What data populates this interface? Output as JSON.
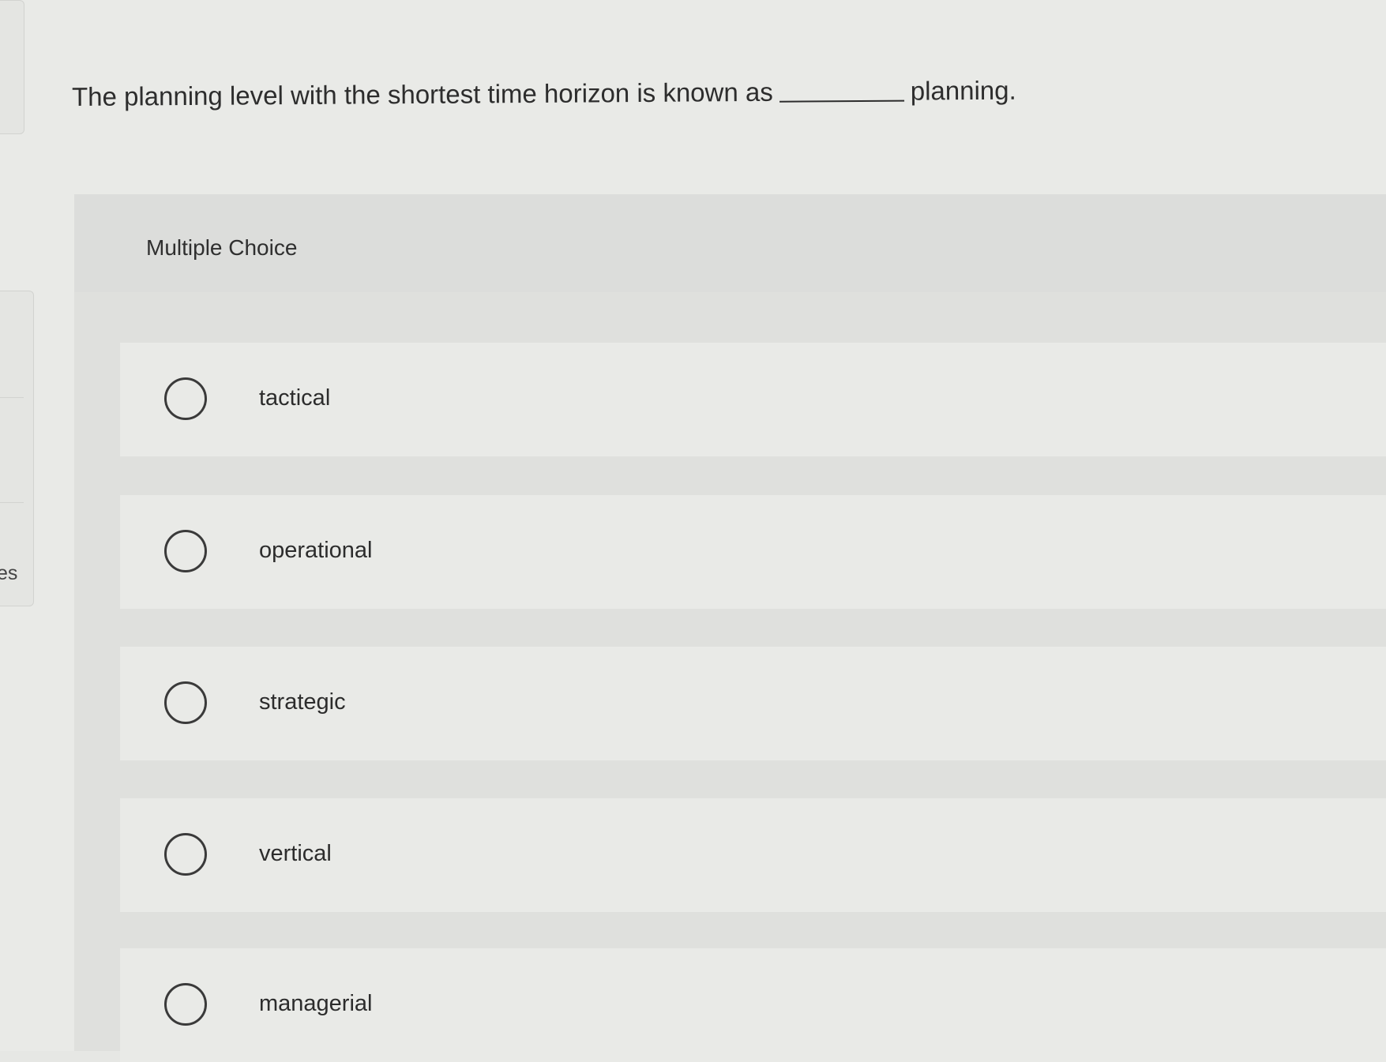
{
  "question": {
    "text_before": "The planning level with the shortest time horizon is known as",
    "text_after": "planning."
  },
  "side_fragment": "es",
  "multiple_choice": {
    "header": "Multiple Choice",
    "options": [
      {
        "label": "tactical",
        "selected": false
      },
      {
        "label": "operational",
        "selected": false
      },
      {
        "label": "strategic",
        "selected": false
      },
      {
        "label": "vertical",
        "selected": false
      },
      {
        "label": "managerial",
        "selected": false
      }
    ]
  },
  "colors": {
    "background": "#e9eae7",
    "header": "#dcdddb",
    "text": "#2c2c2c",
    "radio_border": "#3a3a3a"
  }
}
